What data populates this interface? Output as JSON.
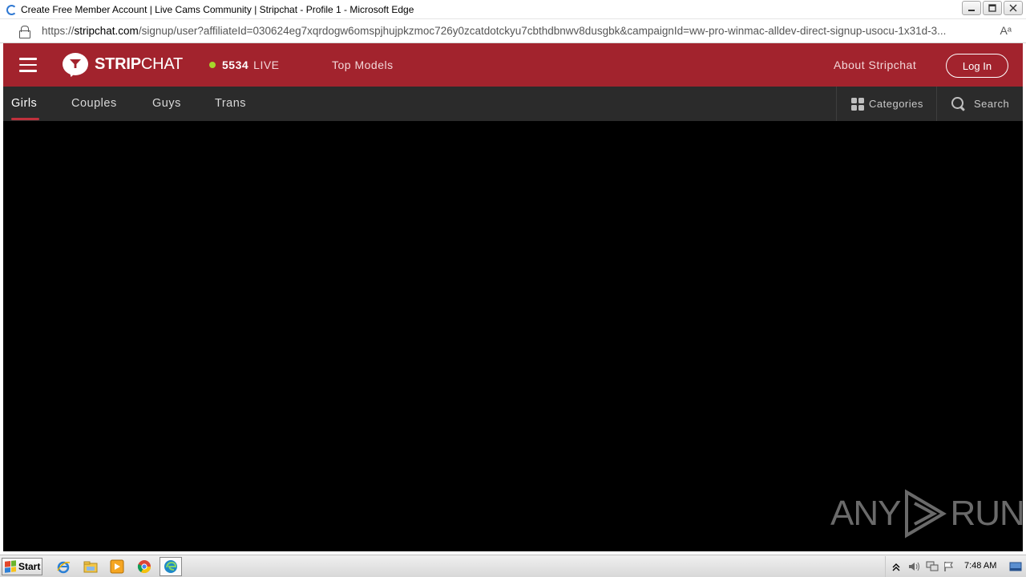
{
  "window": {
    "title": "Create Free Member Account | Live Cams Community | Stripchat - Profile 1 - Microsoft Edge",
    "controls": {
      "minimize": "▭",
      "restore": "⧉",
      "close": "✕"
    }
  },
  "addressbar": {
    "url_prefix": "https://",
    "url_host": "stripchat.com",
    "url_rest": "/signup/user?affiliateId=030624eg7xqrdogw6omspjhujpkzmoc726y0zcatdotckyu7cbthdbnwv8dusgbk&campaignId=ww-pro-winmac-alldev-direct-signup-usocu-1x31d-3...",
    "read_aloud_icon": "Aᵃ"
  },
  "header": {
    "logo_bold": "STRIP",
    "logo_light": "CHAT",
    "live_count": "5534",
    "live_label": "LIVE",
    "top_models": "Top Models",
    "about": "About Stripchat",
    "login": "Log In",
    "brand_color": "#a2232d",
    "live_dot_color": "#a7d62b"
  },
  "subnav": {
    "tabs": [
      {
        "label": "Girls",
        "active": true
      },
      {
        "label": "Couples",
        "active": false
      },
      {
        "label": "Guys",
        "active": false
      },
      {
        "label": "Trans",
        "active": false
      }
    ],
    "categories": "Categories",
    "search": "Search"
  },
  "watermark": {
    "left": "ANY",
    "right": "RUN"
  },
  "taskbar": {
    "start": "Start",
    "clock": "7:48 AM",
    "apps": [
      "ie-icon",
      "explorer-icon",
      "media-player-icon",
      "chrome-icon",
      "edge-icon"
    ]
  }
}
